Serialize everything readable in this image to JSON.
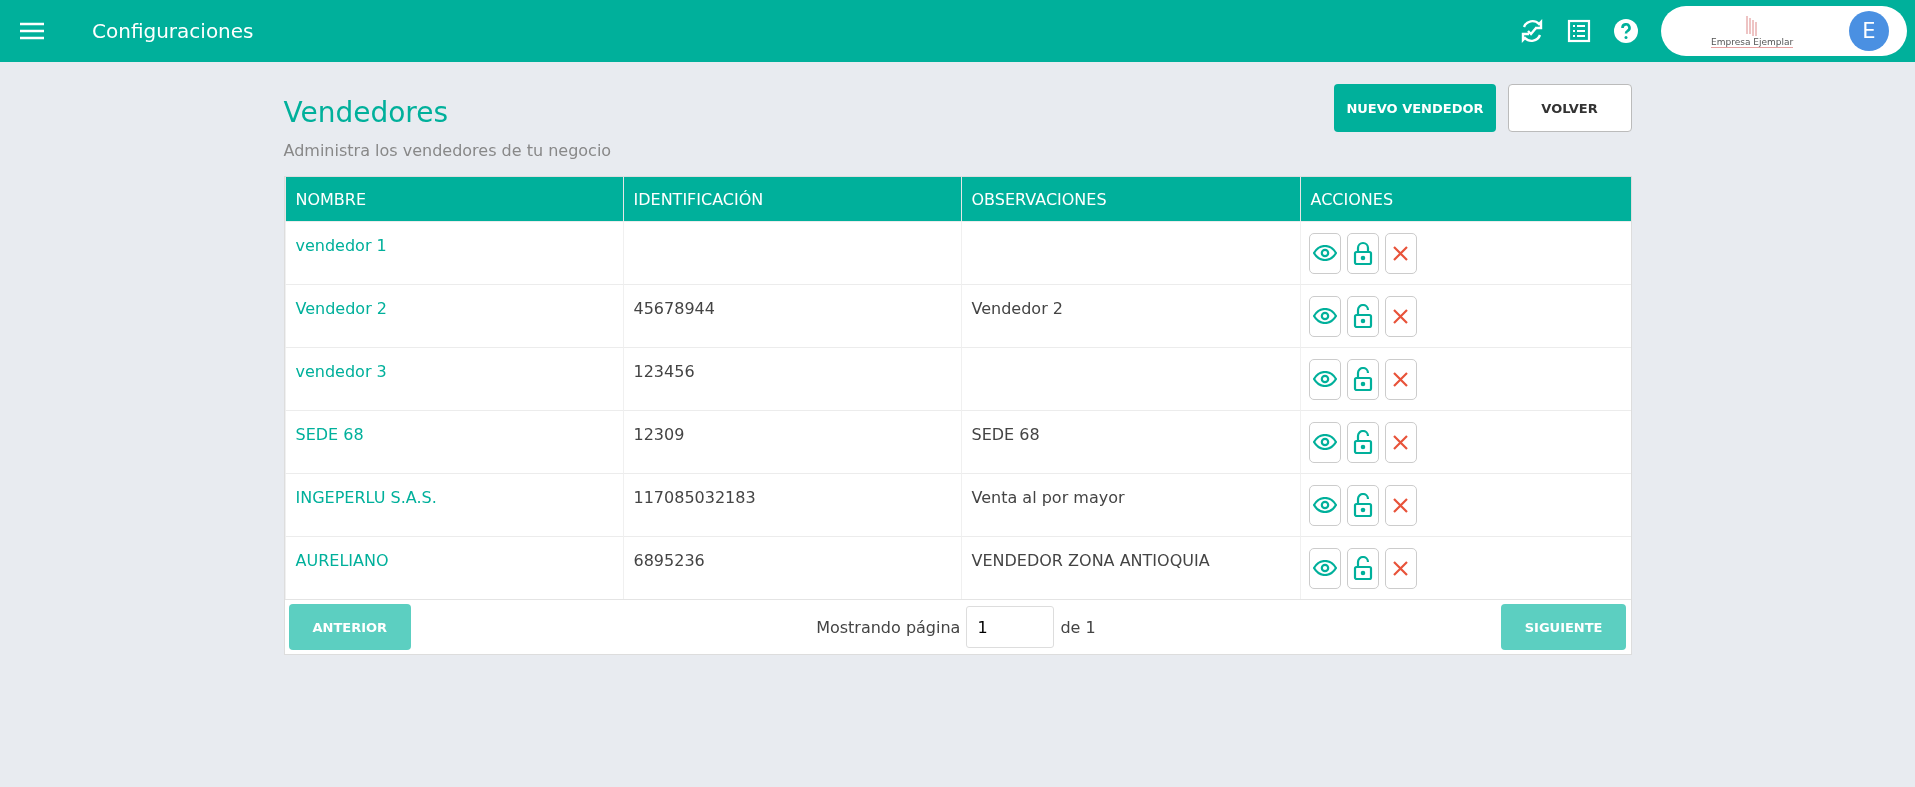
{
  "app_bar": {
    "title": "Configuraciones",
    "company": "Empresa Ejemplar",
    "avatar": "E"
  },
  "page": {
    "title": "Vendedores",
    "subtitle": "Administra los vendedores de tu negocio",
    "buttons": [
      {
        "label": "NUEVO VENDEDOR",
        "kind": "primary"
      },
      {
        "label": "VOLVER",
        "kind": "outline"
      }
    ]
  },
  "table": {
    "columns": [
      "NOMBRE",
      "IDENTIFICACIÓN",
      "OBSERVACIONES",
      "ACCIONES"
    ],
    "rows": [
      {
        "name": "vendedor 1",
        "locked": true
      },
      {
        "name": "Vendedor 2",
        "id": "45678944",
        "notes": "Vendedor 2",
        "locked": false
      },
      {
        "name": "vendedor 3",
        "id": "123456",
        "locked": false
      },
      {
        "name": "SEDE 68",
        "id": "12309",
        "notes": "SEDE 68",
        "locked": false
      },
      {
        "name": "INGEPERLU S.A.S.",
        "id": "117085032183",
        "notes": "Venta al por mayor",
        "locked": false
      },
      {
        "name": "AURELIANO",
        "id": "6895236",
        "notes": "VENDEDOR ZONA ANTIOQUIA",
        "locked": false
      }
    ]
  },
  "pagination": {
    "previous": {
      "label": "ANTERIOR",
      "disabled": true
    },
    "label": "Mostrando página",
    "page": "1",
    "of": "de 1",
    "next": {
      "label": "SIGUIENTE",
      "disabled": true
    }
  }
}
